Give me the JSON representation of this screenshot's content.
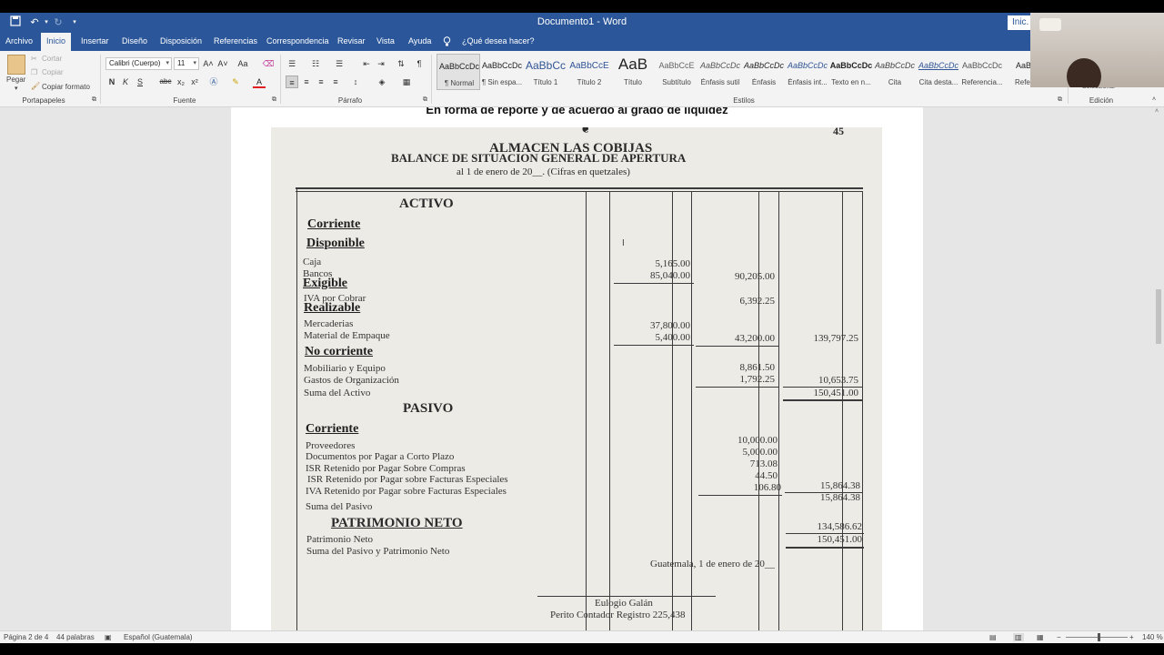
{
  "titlebar": {
    "doc_title": "Documento1 - Word",
    "signin_label": "Inic.",
    "save_icon": "save-icon",
    "undo_icon": "undo-icon",
    "redo_icon": "redo-icon",
    "customize_icon": "customize-icon"
  },
  "tabs": [
    {
      "label": "Archivo"
    },
    {
      "label": "Inicio"
    },
    {
      "label": "Insertar"
    },
    {
      "label": "Diseño"
    },
    {
      "label": "Disposición"
    },
    {
      "label": "Referencias"
    },
    {
      "label": "Correspondencia"
    },
    {
      "label": "Revisar"
    },
    {
      "label": "Vista"
    },
    {
      "label": "Ayuda"
    },
    {
      "label": "¿Qué desea hacer?"
    }
  ],
  "ribbon": {
    "clipboard": {
      "paste": "Pegar",
      "cut": "Cortar",
      "copy": "Copiar",
      "format_painter": "Copiar formato",
      "label": "Portapapeles"
    },
    "font": {
      "font_name": "Calibri (Cuerpo)",
      "font_size": "11",
      "bold": "N",
      "italic": "K",
      "underline": "S",
      "strike": "abc",
      "subscript": "x₂",
      "superscript": "x²",
      "grow": "A˄",
      "shrink": "A˅",
      "case": "Aa",
      "label": "Fuente"
    },
    "paragraph": {
      "label": "Párrafo"
    },
    "styles": {
      "label": "Estilos",
      "items": [
        {
          "preview": "AaBbCcDc",
          "name": "¶ Normal"
        },
        {
          "preview": "AaBbCcDc",
          "name": "¶ Sin espa..."
        },
        {
          "preview": "AaBbCc",
          "name": "Título 1"
        },
        {
          "preview": "AaBbCcE",
          "name": "Título 2"
        },
        {
          "preview": "AaB",
          "name": "Título"
        },
        {
          "preview": "AaBbCcE",
          "name": "Subtítulo"
        },
        {
          "preview": "AaBbCcDc",
          "name": "Énfasis sutil"
        },
        {
          "preview": "AaBbCcDc",
          "name": "Énfasis"
        },
        {
          "preview": "AaBbCcDc",
          "name": "Énfasis int..."
        },
        {
          "preview": "AaBbCcDc",
          "name": "Texto en n..."
        },
        {
          "preview": "AaBbCcDc",
          "name": "Cita"
        },
        {
          "preview": "AaBbCcDc",
          "name": "Cita desta..."
        },
        {
          "preview": "AaBbCcDc",
          "name": "Referencia..."
        },
        {
          "preview": "AaBb",
          "name": "Refere"
        }
      ]
    },
    "editing": {
      "label": "Edición",
      "select": "Seleccionar"
    }
  },
  "document": {
    "headline": "En forma de reporte y de acuerdo al grado de liquidez",
    "scan": {
      "page_number": "45",
      "company": "ALMACEN LAS COBIJAS",
      "report_title": "BALANCE DE SITUACION GENERAL DE APERTURA",
      "report_date": "al 1 de enero de 20__. (Cifras en quetzales)",
      "activo": "ACTIVO",
      "corriente": "Corriente",
      "disponible": "Disponible",
      "caja": "Caja",
      "bancos": "Bancos",
      "exigible": "Exigible",
      "iva_cobrar": "IVA por Cobrar",
      "realizable": "Realizable",
      "mercaderias": "Mercaderias",
      "material": "Material de Empaque",
      "no_corriente": "No corriente",
      "mobiliario": "Mobiliario y Equipo",
      "gastos": "Gastos de Organización",
      "suma_activo": "Suma del Activo",
      "pasivo": "PASIVO",
      "corriente2": "Corriente",
      "proveedores": "Proveedores",
      "documentos": "Documentos por Pagar a Corto Plazo",
      "isr_compras": "ISR Retenido por Pagar Sobre Compras",
      "isr_facturas": "ISR Retenido por Pagar sobre Facturas Especiales",
      "iva_facturas": "IVA Retenido por Pagar sobre Facturas Especiales",
      "suma_pasivo": "Suma del Pasivo",
      "patrimonio_neto_h": "PATRIMONIO NETO",
      "patrimonio_neto": "Patrimonio Neto",
      "suma_pas_pat": "Suma del Pasivo y Patrimonio Neto",
      "lugar_fecha": "Guatemala, 1 de enero de 20__",
      "firma_nombre": "Eulogio Galán",
      "firma_cargo": "Perito Contador Registro 225,438",
      "n_caja": "5,165.00",
      "n_bancos": "85,040.00",
      "n_disponible": "90,205.00",
      "n_iva": "6,392.25",
      "n_merc": "37,800.00",
      "n_mat": "5,400.00",
      "n_realizable": "43,200.00",
      "n_corriente": "139,797.25",
      "n_mob": "8,861.50",
      "n_gastos": "1,792.25",
      "n_nocorr": "10,653.75",
      "n_sumaact": "150,451.00",
      "n_prov": "10,000.00",
      "n_docs": "5,000.00",
      "n_isrc": "713.08",
      "n_isrf": "44.50",
      "n_ivaf": "106.80",
      "n_pcorr": "15,864.38",
      "n_sumapas": "15,864.38",
      "n_pat": "134,586.62",
      "n_sumapaspat": "150,451.00"
    }
  },
  "statusbar": {
    "page": "Página 2 de 4",
    "words": "44 palabras",
    "language": "Español (Guatemala)",
    "zoom": "140 %"
  }
}
